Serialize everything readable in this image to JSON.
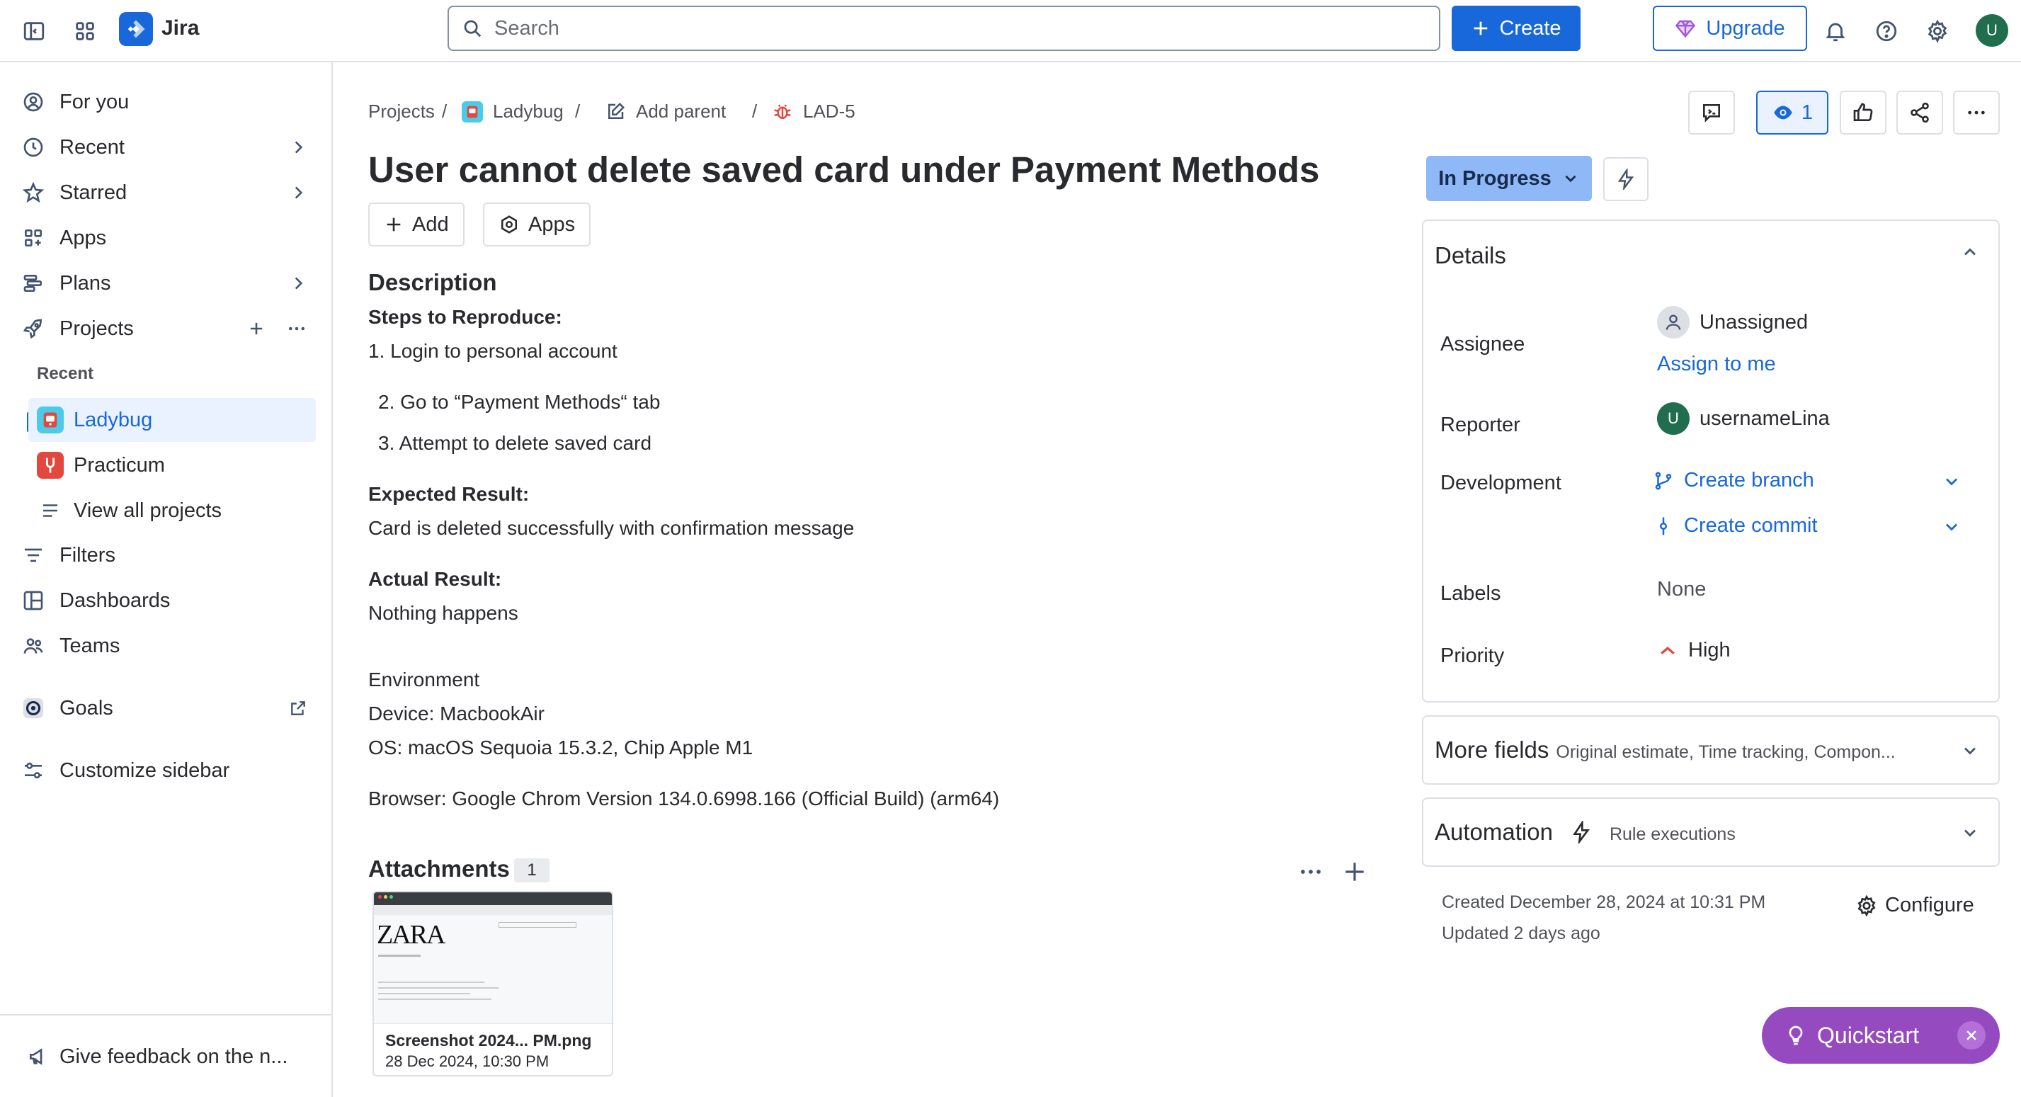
{
  "topbar": {
    "app_name": "Jira",
    "search_placeholder": "Search",
    "create_label": "Create",
    "upgrade_label": "Upgrade",
    "avatar_initial": "U"
  },
  "sidebar": {
    "items": [
      {
        "label": "For you",
        "icon": "user-circle-icon"
      },
      {
        "label": "Recent",
        "icon": "clock-icon"
      },
      {
        "label": "Starred",
        "icon": "star-icon"
      },
      {
        "label": "Apps",
        "icon": "apps-icon"
      },
      {
        "label": "Plans",
        "icon": "plans-icon"
      },
      {
        "label": "Projects",
        "icon": "rocket-icon"
      }
    ],
    "recent_heading": "Recent",
    "projects": [
      {
        "label": "Ladybug",
        "active": true
      },
      {
        "label": "Practicum",
        "active": false
      }
    ],
    "view_all": "View all projects",
    "filters": "Filters",
    "dashboards": "Dashboards",
    "teams": "Teams",
    "goals": "Goals",
    "customize": "Customize sidebar",
    "feedback": "Give feedback on the n..."
  },
  "breadcrumb": {
    "projects": "Projects",
    "project": "Ladybug",
    "add_parent": "Add parent",
    "issue_key": "LAD-5"
  },
  "issue": {
    "title": "User cannot delete saved card under Payment Methods",
    "add_label": "Add",
    "apps_label": "Apps",
    "description_heading": "Description",
    "steps_heading": "Steps to Reproduce:",
    "step1": "1. Login to personal account",
    "step2": "2. Go to “Payment Methods“ tab",
    "step3": "3. Attempt to delete saved card",
    "expected_heading": "Expected Result:",
    "expected": "Card is deleted successfully with confirmation message",
    "actual_heading": "Actual Result:",
    "actual": "Nothing happens",
    "env_heading": "Environment",
    "device": "Device: MacbookAir",
    "os": "OS: macOS Sequoia 15.3.2, Chip Apple M1",
    "browser": "Browser: Google Chrom Version 134.0.6998.166 (Official Build) (arm64)",
    "attachments_heading": "Attachments",
    "attachments_count": "1",
    "attachment": {
      "name": "Screenshot 2024...  PM.png",
      "date": "28 Dec 2024, 10:30 PM",
      "thumb_brand": "ZARA"
    }
  },
  "actions": {
    "watch_count": "1",
    "status": "In Progress"
  },
  "details": {
    "heading": "Details",
    "assignee_label": "Assignee",
    "assignee_value": "Unassigned",
    "assign_to_me": "Assign to me",
    "reporter_label": "Reporter",
    "reporter_initial": "U",
    "reporter_value": "usernameLina",
    "development_label": "Development",
    "create_branch": "Create branch",
    "create_commit": "Create commit",
    "labels_label": "Labels",
    "labels_value": "None",
    "priority_label": "Priority",
    "priority_value": "High"
  },
  "more_fields": {
    "heading": "More fields",
    "hint": "Original estimate, Time tracking, Compon..."
  },
  "automation": {
    "heading": "Automation",
    "hint": "Rule executions"
  },
  "meta": {
    "created": "Created December 28, 2024 at 10:31 PM",
    "updated": "Updated 2 days ago",
    "configure": "Configure"
  },
  "quickstart": {
    "label": "Quickstart"
  },
  "colors": {
    "brand_blue": "#1868db",
    "status_bg": "#8fb8f6",
    "quickstart_purple": "#964ac0",
    "avatar_green": "#216e4e",
    "priority_red": "#e2483d"
  }
}
